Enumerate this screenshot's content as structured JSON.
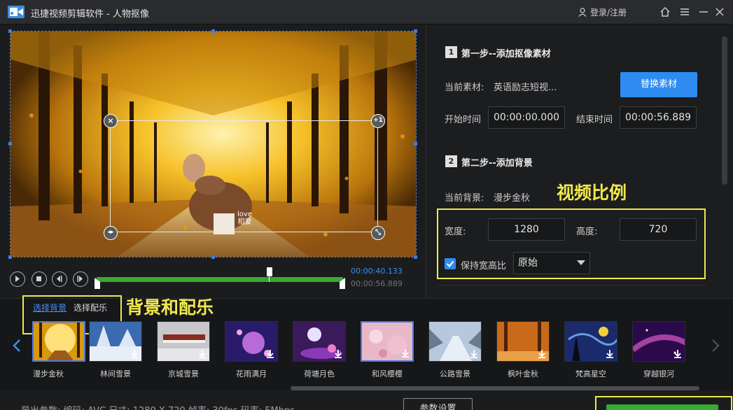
{
  "window": {
    "title": "迅捷视频剪辑软件 - 人物抠像",
    "login_label": "登录/注册",
    "icons": [
      "app-logo-icon",
      "user-icon",
      "home-icon",
      "menu-icon",
      "close-icon"
    ]
  },
  "preview": {
    "overlay_text_line1": "love",
    "overlay_text_line2": "相爱",
    "handle_add": "+1",
    "handle_close": "×"
  },
  "playback": {
    "current_time": "00:00:40.133",
    "total_time": "00:00:56.889",
    "trim_progress": 0.7
  },
  "step1": {
    "num": "1",
    "title": "第一步--添加抠像素材",
    "material_label": "当前素材:",
    "material_value": "英语励志短视...",
    "replace_button": "替换素材",
    "start_label": "开始时间",
    "start_value": "00:00:00.000",
    "end_label": "结束时间",
    "end_value": "00:00:56.889"
  },
  "step2": {
    "num": "2",
    "title": "第二步--添加背景",
    "bg_label": "当前背景:",
    "bg_value": "漫步金秋",
    "width_label": "宽度:",
    "width_value": "1280",
    "height_label": "高度:",
    "height_value": "720",
    "keep_ratio_label": "保持宽高比",
    "keep_ratio_checked": true,
    "ratio_option": "原始"
  },
  "annotations": {
    "ratio_note": "视频比例",
    "bg_music_note": "背景和配乐"
  },
  "background_bar": {
    "tab_bg": "选择背景",
    "tab_music": "选择配乐",
    "items": [
      {
        "label": "漫步金秋",
        "selected": true,
        "download": false
      },
      {
        "label": "林间雪景",
        "selected": false,
        "download": true
      },
      {
        "label": "京城雪景",
        "selected": false,
        "download": true
      },
      {
        "label": "花雨满月",
        "selected": false,
        "download": true
      },
      {
        "label": "荷塘月色",
        "selected": false,
        "download": true
      },
      {
        "label": "和风樱樱",
        "selected": true,
        "download": true
      },
      {
        "label": "公路雪景",
        "selected": false,
        "download": true
      },
      {
        "label": "枫叶金秋",
        "selected": false,
        "download": true
      },
      {
        "label": "梵高星空",
        "selected": false,
        "download": true
      },
      {
        "label": "穿越银河",
        "selected": false,
        "download": true
      }
    ]
  },
  "footer": {
    "export_info": "导出参数: 编码: AVC    尺寸: 1280 X 720    帧率: 30fps    码率: 5Mbps",
    "param_button": "参数设置"
  },
  "colors": {
    "accent": "#2e8cf0",
    "progress": "#3aa832",
    "annotation": "#f0e94c"
  }
}
